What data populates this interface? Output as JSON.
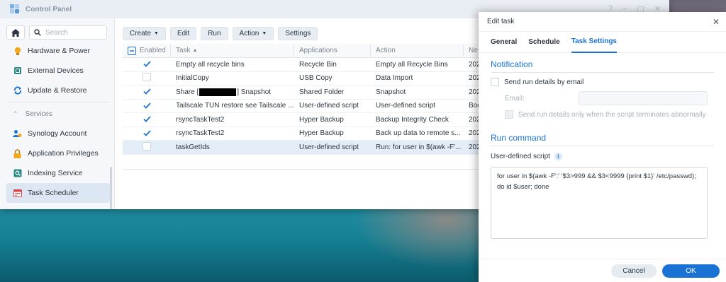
{
  "window": {
    "title": "Control Panel"
  },
  "sidebar": {
    "search_placeholder": "Search",
    "items": [
      {
        "label": "Hardware & Power",
        "icon": "bulb-icon"
      },
      {
        "label": "External Devices",
        "icon": "external-device-icon"
      },
      {
        "label": "Update & Restore",
        "icon": "refresh-icon"
      }
    ],
    "section": "Services",
    "service_items": [
      {
        "label": "Synology Account",
        "icon": "user-icon"
      },
      {
        "label": "Application Privileges",
        "icon": "lock-icon"
      },
      {
        "label": "Indexing Service",
        "icon": "index-icon"
      },
      {
        "label": "Task Scheduler",
        "icon": "calendar-icon",
        "active": true
      }
    ]
  },
  "toolbar": {
    "create": "Create",
    "edit": "Edit",
    "run": "Run",
    "action": "Action",
    "settings": "Settings"
  },
  "table": {
    "headers": {
      "enabled": "Enabled",
      "task": "Task",
      "applications": "Applications",
      "action": "Action",
      "next": "Ne"
    },
    "rows": [
      {
        "enabled": true,
        "task": "Empty all recycle bins",
        "app": "Recycle Bin",
        "action": "Empty all Recycle Bins",
        "next": "202"
      },
      {
        "enabled": false,
        "task": "InitialCopy",
        "app": "USB Copy",
        "action": "Data Import",
        "next": "202"
      },
      {
        "enabled": true,
        "task_prefix": "Share [",
        "task_suffix": "] Snapshot",
        "app": "Shared Folder",
        "action": "Snapshot",
        "next": "202"
      },
      {
        "enabled": true,
        "task": "Tailscale TUN restore see Tailscale ...",
        "app": "User-defined script",
        "action": "User-defined script",
        "next": "Boo"
      },
      {
        "enabled": true,
        "task": "rsyncTaskTest2",
        "app": "Hyper Backup",
        "action": "Backup Integrity Check",
        "next": "202"
      },
      {
        "enabled": true,
        "task": "rsyncTaskTest2",
        "app": "Hyper Backup",
        "action": "Back up data to remote s...",
        "next": "202"
      },
      {
        "enabled": false,
        "task": "taskGetIds",
        "app": "User-defined script",
        "action": "Run: for user in $(awk -F'...",
        "next": "202",
        "selected": true
      }
    ]
  },
  "dialog": {
    "title": "Edit task",
    "tabs": [
      "General",
      "Schedule",
      "Task Settings"
    ],
    "active_tab": "Task Settings",
    "notification_title": "Notification",
    "send_email_label": "Send run details by email",
    "email_label": "Email:",
    "email_value": "",
    "abnormal_label": "Send run details only when the script terminates abnormally",
    "run_command_title": "Run command",
    "script_label": "User-defined script",
    "script": "for user in $(awk -F':' '$3>999 && $3<9999 {print $1}' /etc/passwd); do id $user; done",
    "cancel": "Cancel",
    "ok": "OK"
  },
  "colors": {
    "accent": "#1a73d4",
    "selected_row": "#e3edf8"
  }
}
